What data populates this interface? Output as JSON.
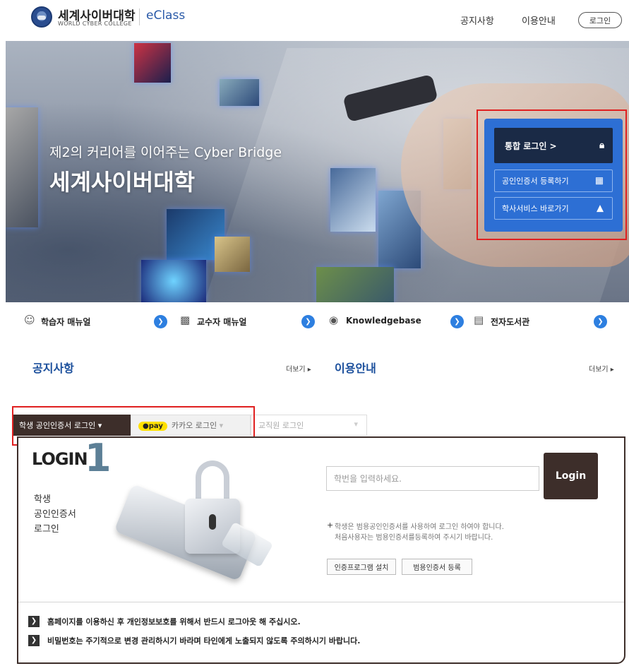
{
  "header": {
    "logo_kr": "세계사이버대학",
    "logo_en": "WORLD CYBER COLLEGE",
    "eclass": "eClass",
    "nav": [
      "공지사항",
      "이용안내"
    ],
    "login_button": "로그인"
  },
  "hero": {
    "subtitle": "제2의 커리어를 이어주는 Cyber Bridge",
    "title": "세계사이버대학",
    "quick": {
      "sso_label": "통합 로그인 >",
      "cert_label": "공인인증서 등록하기",
      "academic_label": "학사서비스 바로가기"
    }
  },
  "manuals": [
    {
      "label": "학습자 매뉴얼",
      "icon": "person-icon"
    },
    {
      "label": "교수자 매뉴얼",
      "icon": "teacher-icon"
    },
    {
      "label": "Knowledgebase",
      "icon": "media-icon"
    },
    {
      "label": "전자도서관",
      "icon": "book-icon"
    }
  ],
  "sections": {
    "notice_title": "공지사항",
    "notice_more": "더보기 ▸",
    "guide_title": "이용안내",
    "guide_more": "더보기 ▸"
  },
  "login_tabs": {
    "cert": "학생 공인인증서 로그인",
    "kakao_badge": "●pay",
    "kakao": "카카오 로그인",
    "staff": "교직원 로그인",
    "active": "cert"
  },
  "login_panel": {
    "wordmark": "LOGIN",
    "number": "1",
    "desc_lines": [
      "학생",
      "공인인증서",
      "로그인"
    ],
    "id_placeholder": "학번을 입력하세요.",
    "login_button": "Login",
    "notice_1": "학생은 범용공인인증서를 사용하여 로그인 하여야 합니다.",
    "notice_2": "처음사용자는 범용인증서를등록하여 주시기 바랍니다.",
    "install_button": "인증프로그램 설치",
    "register_button": "범용인증서 등록"
  },
  "info": [
    "홈페이지를 이용하신 후 개인정보보호를 위해서 반드시 로그아웃 해 주십시오.",
    "비밀번호는 주기적으로 변경 관리하시기 바라며 타인에게 노출되지 않도록 주의하시기 바랍니다."
  ],
  "colors": {
    "accent_blue": "#2d6fd4",
    "dark_navy": "#1a2a46",
    "brown": "#3d2e2a",
    "highlight_red": "#e02020",
    "kakao_yellow": "#ffe000"
  }
}
